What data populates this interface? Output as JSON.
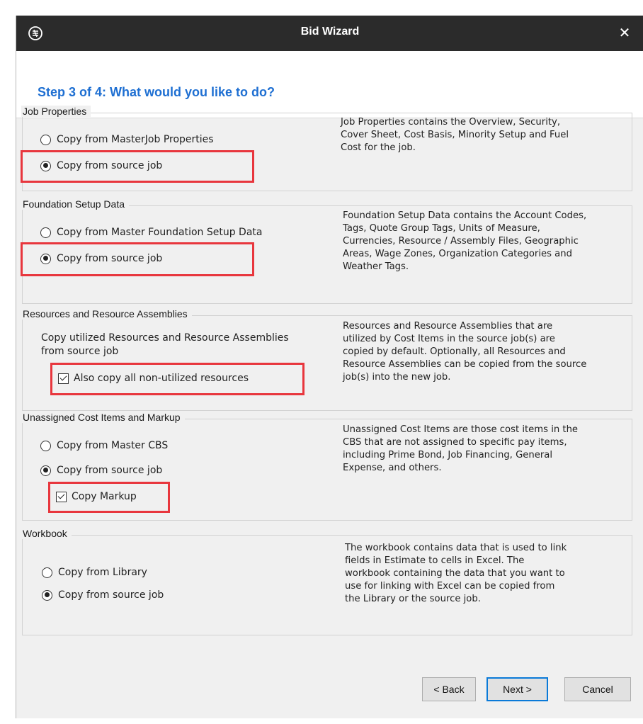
{
  "window": {
    "title": "Bid Wizard",
    "app_icon": "app-logo-icon",
    "close_icon": "close-icon",
    "close_glyph": "✕"
  },
  "step": "Step 3 of 4: What would you like to do?",
  "groups": {
    "job_properties": {
      "legend": "Job Properties",
      "options": [
        {
          "label": "Copy from MasterJob Properties",
          "selected": false
        },
        {
          "label": "Copy from source job",
          "selected": true
        }
      ],
      "description": "Job Properties contains the Overview, Security,\nCover Sheet, Cost Basis, Minority Setup and Fuel\nCost for the job."
    },
    "foundation": {
      "legend": "Foundation Setup Data",
      "options": [
        {
          "label": "Copy from Master Foundation Setup Data",
          "selected": false
        },
        {
          "label": "Copy from source job",
          "selected": true
        }
      ],
      "description": "Foundation Setup Data contains the Account Codes,\nTags, Quote Group Tags, Units of Measure,\nCurrencies, Resource / Assembly Files, Geographic\nAreas, Wage Zones, Organization Categories and\nWeather Tags."
    },
    "resources": {
      "legend": "Resources and Resource Assemblies",
      "info": "Copy utilized Resources and Resource Assemblies\nfrom source job",
      "checkbox": {
        "label": "Also copy all non-utilized resources",
        "checked": true
      },
      "description": "Resources and Resource Assemblies that are\nutilized by Cost Items in the source job(s) are\ncopied by default.  Optionally, all Resources and\nResource Assemblies can be copied from the source\njob(s) into the new job."
    },
    "unassigned": {
      "legend": "Unassigned Cost Items and Markup",
      "options": [
        {
          "label": "Copy from Master CBS",
          "selected": false
        },
        {
          "label": "Copy from source job",
          "selected": true
        }
      ],
      "checkbox": {
        "label": "Copy Markup",
        "checked": true
      },
      "description": "Unassigned Cost Items are those cost items in the\nCBS that are not assigned to specific pay items,\nincluding Prime Bond, Job Financing, General\nExpense, and others."
    },
    "workbook": {
      "legend": "Workbook",
      "options": [
        {
          "label": "Copy from Library",
          "selected": false
        },
        {
          "label": "Copy from source job",
          "selected": true
        }
      ],
      "description": "The workbook contains data that is used to link\nfields in Estimate to cells in Excel. The\nworkbook containing the data that you want to\nuse for linking with Excel can be copied from\nthe Library or the source job."
    }
  },
  "buttons": {
    "back": "< Back",
    "next": "Next >",
    "cancel": "Cancel"
  },
  "colors": {
    "highlight": "#e8363d",
    "step_title": "#1e6fd2",
    "titlebar": "#2b2b2b",
    "primary_border": "#0a7ad8"
  }
}
